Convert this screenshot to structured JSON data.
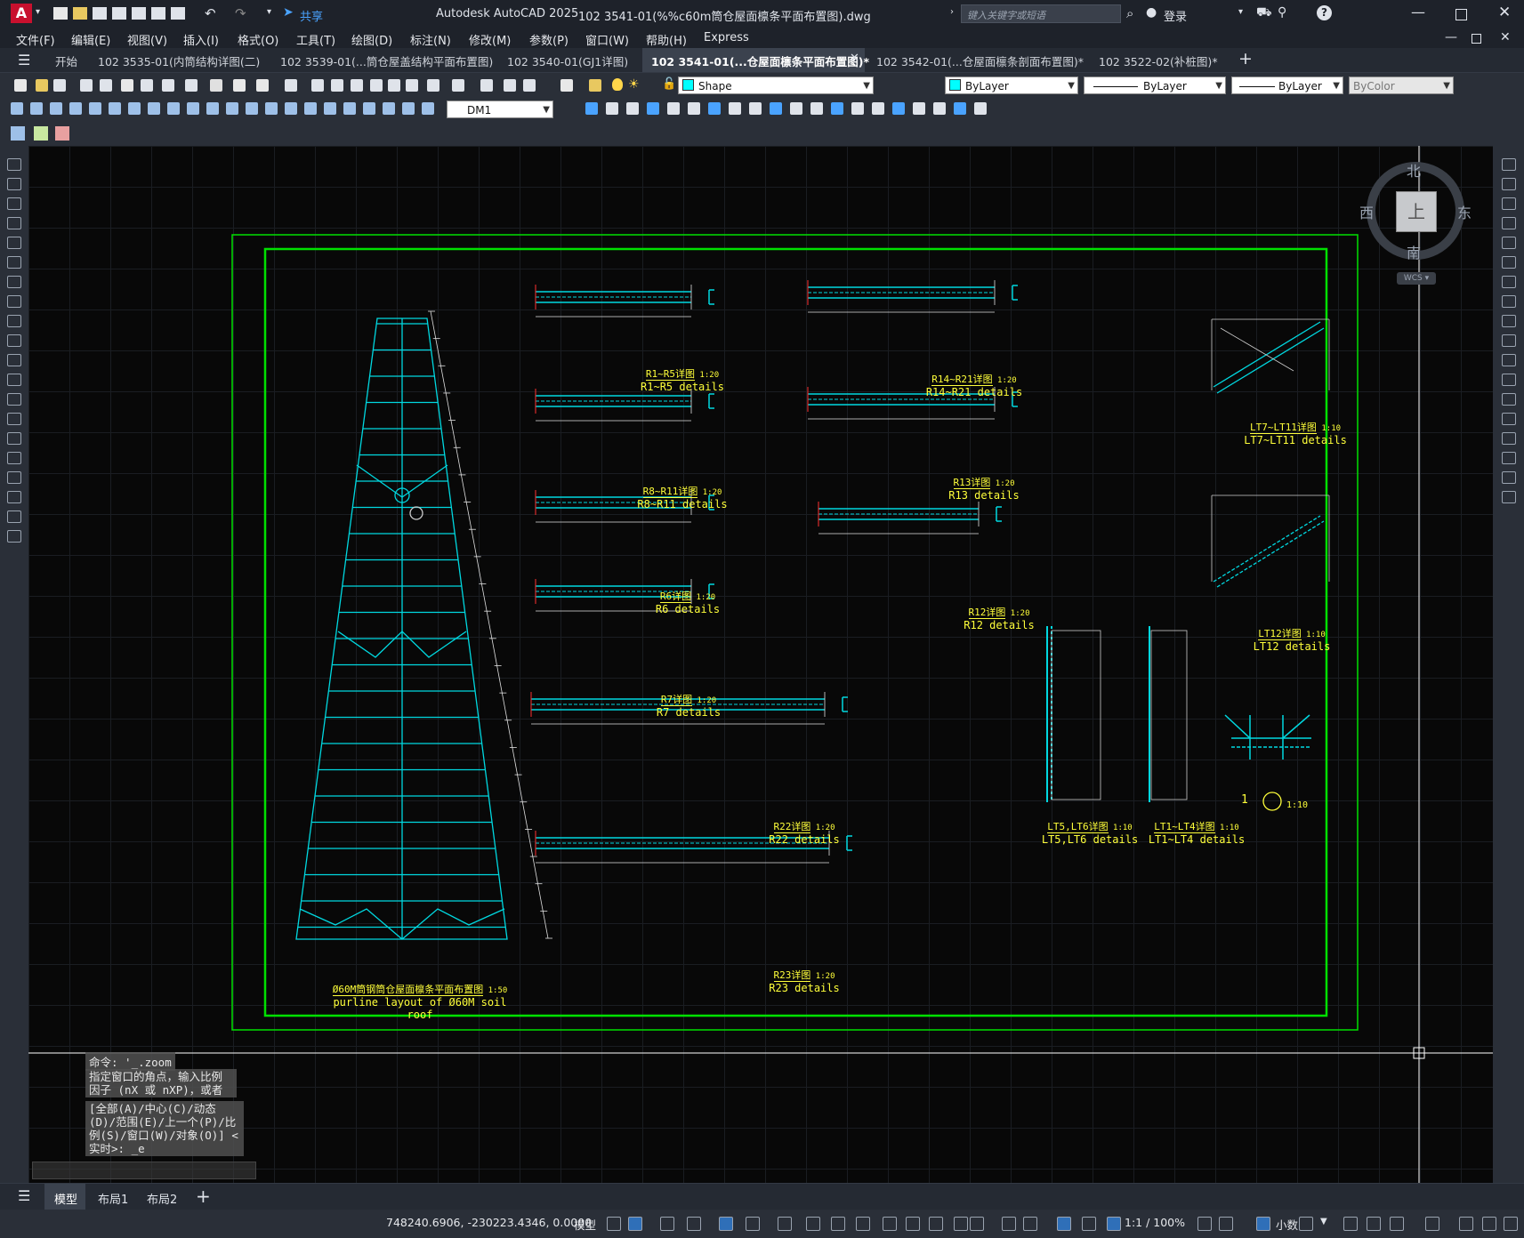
{
  "window": {
    "app_title": "Autodesk AutoCAD 2025",
    "file_title": "102 3541-01(%%c60m筒仓屋面檩条平面布置图).dwg",
    "search_placeholder": "键入关键字或短语",
    "login": "登录",
    "share": "共享"
  },
  "menu": [
    "文件(F)",
    "编辑(E)",
    "视图(V)",
    "插入(I)",
    "格式(O)",
    "工具(T)",
    "绘图(D)",
    "标注(N)",
    "修改(M)",
    "参数(P)",
    "窗口(W)",
    "帮助(H)",
    "Express"
  ],
  "tabs": [
    {
      "label": "开始",
      "active": false
    },
    {
      "label": "102 3535-01(内筒结构详图(二)",
      "active": false
    },
    {
      "label": "102 3539-01(...筒仓屋盖结构平面布置图)",
      "active": false
    },
    {
      "label": "102 3540-01(GJ1详图)",
      "active": false
    },
    {
      "label": "102 3541-01(...仓屋面檩条平面布置图)*",
      "active": true
    },
    {
      "label": "102 3542-01(...仓屋面檩条剖面布置图)*",
      "active": false
    },
    {
      "label": "102 3522-02(补桩图)*",
      "active": false
    }
  ],
  "toolbar": {
    "layer_name": "Shape",
    "color": "ByLayer",
    "linetype": "ByLayer",
    "lineweight": "ByLayer",
    "plotstyle": "ByColor",
    "dim_style": "DM1"
  },
  "viewcube": {
    "north": "北",
    "south": "南",
    "east": "东",
    "west": "西",
    "top": "上",
    "wcs": "WCS"
  },
  "drawing": {
    "main_title_cn": "Ø60M筒钢筒仓屋面檩条平面布置图",
    "main_title_scale": "1:50",
    "main_title_en": "purline layout of Ø60M soil roof",
    "details": [
      {
        "cn": "R1~R5详图",
        "scale": "1:20",
        "en": "R1~R5 details"
      },
      {
        "cn": "R14~R21详图",
        "scale": "1:20",
        "en": "R14~R21 details"
      },
      {
        "cn": "LT7~LT11详图",
        "scale": "1:10",
        "en": "LT7~LT11 details"
      },
      {
        "cn": "R8~R11详图",
        "scale": "1:20",
        "en": "R8~R11 details"
      },
      {
        "cn": "R13详图",
        "scale": "1:20",
        "en": "R13 details"
      },
      {
        "cn": "R6详图",
        "scale": "1:20",
        "en": "R6 details"
      },
      {
        "cn": "R12详图",
        "scale": "1:20",
        "en": "R12 details"
      },
      {
        "cn": "LT12详图",
        "scale": "1:10",
        "en": "LT12 details"
      },
      {
        "cn": "R7详图",
        "scale": "1:20",
        "en": "R7 details"
      },
      {
        "cn": "R22详图",
        "scale": "1:20",
        "en": "R22 details"
      },
      {
        "cn": "LT5,LT6详图",
        "scale": "1:10",
        "en": "LT5,LT6 details"
      },
      {
        "cn": "LT1~LT4详图",
        "scale": "1:10",
        "en": "LT1~LT4 details"
      },
      {
        "cn": "R23详图",
        "scale": "1:20",
        "en": "R23 details"
      }
    ],
    "section_marker": "1",
    "section_scale": "1:10"
  },
  "command": {
    "history": [
      "命令: '_.zoom",
      "指定窗口的角点，输入比例因子 (nX 或 nXP)，或者",
      "[全部(A)/中心(C)/动态(D)/范围(E)/上一个(P)/比例(S)/窗口(W)/对象(O)] <实时>: _e"
    ]
  },
  "layouts": {
    "model": "模型",
    "layout1": "布局1",
    "layout2": "布局2"
  },
  "status": {
    "coords": "748240.6906, -230223.4346, 0.0000",
    "model": "模型",
    "scale": "1:1 / 100%",
    "units": "小数"
  }
}
